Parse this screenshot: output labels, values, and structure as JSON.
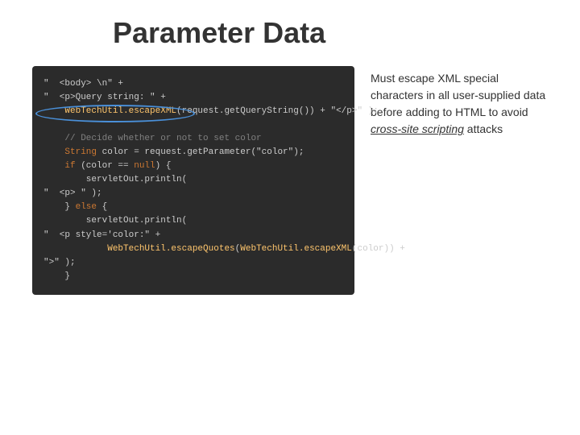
{
  "page": {
    "title": "Parameter Data",
    "background": "#ffffff"
  },
  "description": {
    "text_part1": "Must escape XML special characters in all user-supplied data before adding to HTML to avoid ",
    "text_italic": "cross-site scripting",
    "text_part2": " attacks"
  },
  "code": {
    "lines": [
      "\"  <body> \\n\" +",
      "\"  <p>Query string: \" +",
      "    WebTechUtil.escapeXML(request.getQueryString()) + \"</p>\" );",
      "",
      "    // Decide whether or not to set color",
      "    String color = request.getParameter(\"color\");",
      "    if (color == null) {",
      "        servletOut.println(",
      "\"  <p> \" );",
      "    } else {",
      "        servletOut.println(",
      "\"  <p style='color:\" +",
      "            WebTechUtil.escapeQuotes(WebTechUtil.escapeXML(color)) +",
      "\">\" );",
      "    }"
    ],
    "highlight_label": "String color"
  }
}
